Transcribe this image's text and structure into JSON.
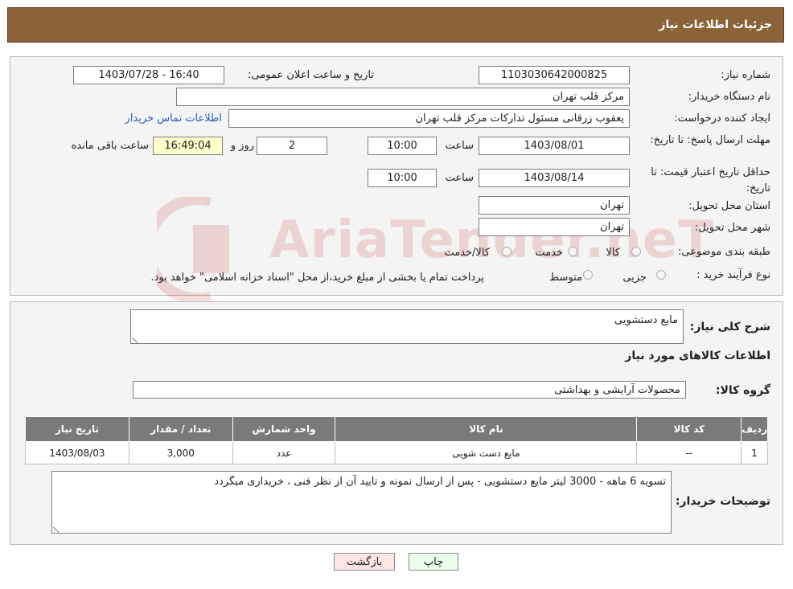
{
  "header": {
    "title": "جزئیات اطلاعات نیاز"
  },
  "form": {
    "need_number_label": "شماره نیاز:",
    "need_number": "1103030642000825",
    "announce_label": "تاریخ و ساعت اعلان عمومی:",
    "announce_value": "1403/07/28 - 16:40",
    "buyer_org_label": "نام دستگاه خریدار:",
    "buyer_org": "مرکز قلب تهران",
    "requester_label": "ایجاد کننده درخواست:",
    "requester": "یعقوب زرقانی مسئول تدارکات مرکز قلب تهران",
    "contact_link": "اطلاعات تماس خریدار",
    "reply_deadline_label": "مهلت ارسال پاسخ: تا تاریخ:",
    "reply_date": "1403/08/01",
    "time_label": "ساعت",
    "reply_time": "10:00",
    "days_value": "2",
    "days_label": "روز و",
    "remaining_time": "16:49:04",
    "remaining_label": "ساعت باقی مانده",
    "price_validity_label": "حداقل تاریخ اعتبار قیمت: تا تاریخ:",
    "price_date": "1403/08/14",
    "price_time": "10:00",
    "province_label": "استان محل تحویل:",
    "province": "تهران",
    "city_label": "شهر محل تحویل:",
    "city": "تهران",
    "category_label": "طبقه بندی موضوعی:",
    "category_options": [
      "کالا",
      "خدمت",
      "کالا/خدمت"
    ],
    "process_label": "نوع فرآیند خرید :",
    "process_options": [
      "جزیی",
      "متوسط"
    ],
    "process_note": "پرداخت تمام یا بخشی از مبلغ خرید،از محل \"اسناد خزانه اسلامی\" خواهد بود."
  },
  "needs": {
    "description_label": "شرح کلی نیاز:",
    "description": "مایع دستشویی",
    "goods_info_title": "اطلاعات کالاهای مورد نیاز",
    "goods_group_label": "گروه کالا:",
    "goods_group": "محصولات آرایشی و بهداشتی",
    "table": {
      "headers": [
        "ردیف",
        "کد کالا",
        "نام کالا",
        "واحد شمارش",
        "تعداد / مقدار",
        "تاریخ نیاز"
      ],
      "rows": [
        [
          "1",
          "--",
          "مایع دست شویی",
          "عدد",
          "3,000",
          "1403/08/03"
        ]
      ]
    },
    "buyer_notes_label": "توضیحات خریدار:",
    "buyer_notes": "تسویه 6 ماهه  -  3000 لیتر مایع دستشویی  - پس از ارسال نمونه و تایید آن از نظر فنی ، خریداری میگردد"
  },
  "buttons": {
    "print": "چاپ",
    "back": "بازگشت"
  },
  "watermark": {
    "text": "AriaTender.neT"
  },
  "colors": {
    "header_bg": "#8a6339",
    "link": "#2a5dbf",
    "print_bg": "#eaffea",
    "back_bg": "#ffe6e6"
  }
}
